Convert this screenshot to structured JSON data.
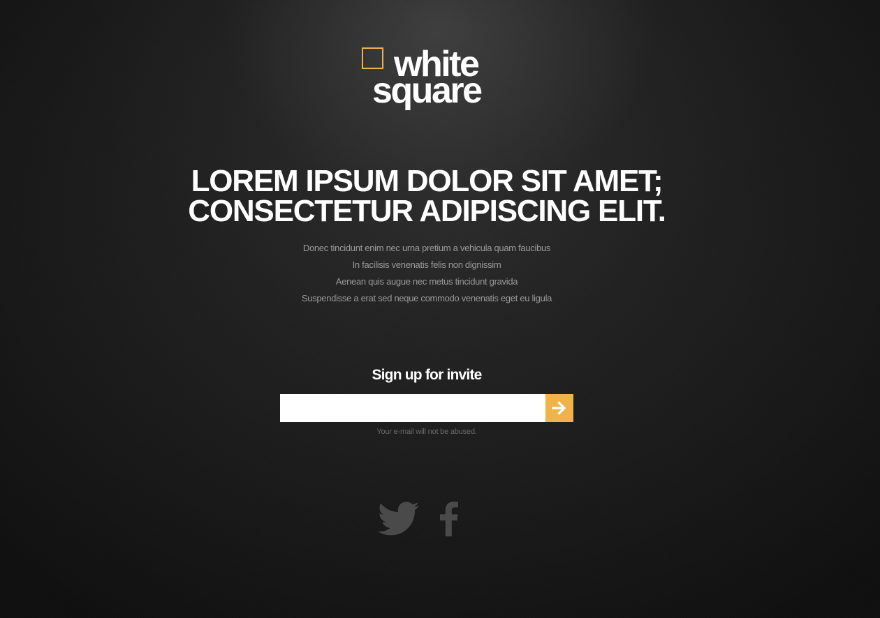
{
  "brand": {
    "line1": "white",
    "line2": "square",
    "accent_color": "#f0b24a"
  },
  "headline": {
    "line1": "LOREM IPSUM DOLOR SIT AMET;",
    "line2": "CONSECTETUR ADIPISCING ELIT."
  },
  "subtext": [
    "Donec tincidunt enim nec urna pretium a vehicula quam faucibus",
    "In facilisis venenatis felis non dignissim",
    "Aenean quis augue nec metus tincidunt gravida",
    "Suspendisse a erat sed neque commodo venenatis eget eu ligula"
  ],
  "signup": {
    "title": "Sign up for invite",
    "email_value": "",
    "email_placeholder": "",
    "submit_icon": "arrow-right-icon",
    "note": "Your e-mail will not be abused."
  },
  "social": [
    {
      "name": "twitter",
      "icon": "twitter-icon"
    },
    {
      "name": "facebook",
      "icon": "facebook-icon"
    }
  ],
  "colors": {
    "background": "#1c1c1c",
    "text": "#ffffff",
    "muted": "#9a9a9a",
    "icon": "#4a4a4a"
  }
}
